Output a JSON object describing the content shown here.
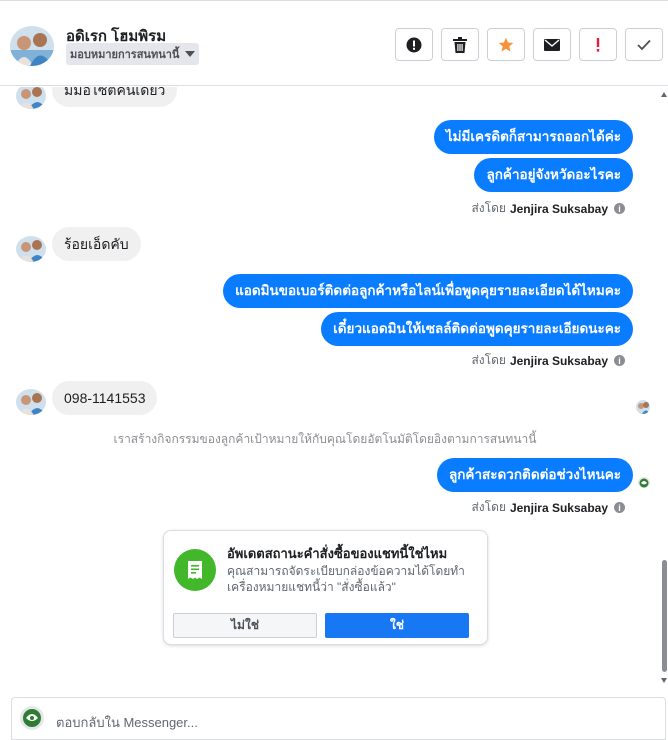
{
  "header": {
    "contact_name": "อดิเรก โฮมพิรม",
    "assign_label": "มอบหมายการสนทนานี้",
    "action_icons": [
      "exclamation-circle-icon",
      "trash-icon",
      "star-icon",
      "envelope-icon",
      "exclamation-icon",
      "check-icon"
    ],
    "colors": {
      "star": "#f7923b",
      "alert": "#e41e3f"
    }
  },
  "messages": {
    "m1": "มีมอไซต์คันเดียว",
    "m2": "ไม่มีเครดิตก็สามารถออกได้ค่ะ",
    "m3": "ลูกค้าอยู่จังหวัดอะไรคะ",
    "m4": "ร้อยเอ็ดคับ",
    "m5": "แอดมินขอเบอร์ติดต่อลูกค้าหรือไลน์เพื่อพูดคุยรายละเอียดได้ไหมคะ",
    "m6": "เดี๋ยวแอดมินให้เซลล์ติดต่อพูดคุยรายละเอียดนะคะ",
    "m7": "098-1141553",
    "m8": "ลูกค้าสะดวกติดต่อช่วงไหนคะ"
  },
  "sent_by": {
    "prefix": "ส่งโดย",
    "name": "Jenjira Suksabay",
    "info_icon": "i"
  },
  "system_note": "เราสร้างกิจกรรมของลูกค้าเป้าหมายให้กับคุณโดยอัตโนมัติโดยอิงตามการสนทนานี้",
  "card": {
    "title": "อัพเดตสถานะคำสั่งซื้อของแชทนี้ใช่ไหม",
    "body": "คุณสามารถจัดระเบียบกล่องข้อความได้โดยทำเครื่องหมายแชทนี้ว่า \"สั่งซื้อแล้ว\"",
    "no_label": "ไม่ใช่",
    "yes_label": "ใช่",
    "icon": "receipt-icon",
    "icon_color": "#42b72a"
  },
  "composer": {
    "placeholder": "ตอบกลับใน Messenger..."
  },
  "colors": {
    "outgoing_bubble": "#0a7cff",
    "incoming_bubble": "#f0f0f0"
  }
}
